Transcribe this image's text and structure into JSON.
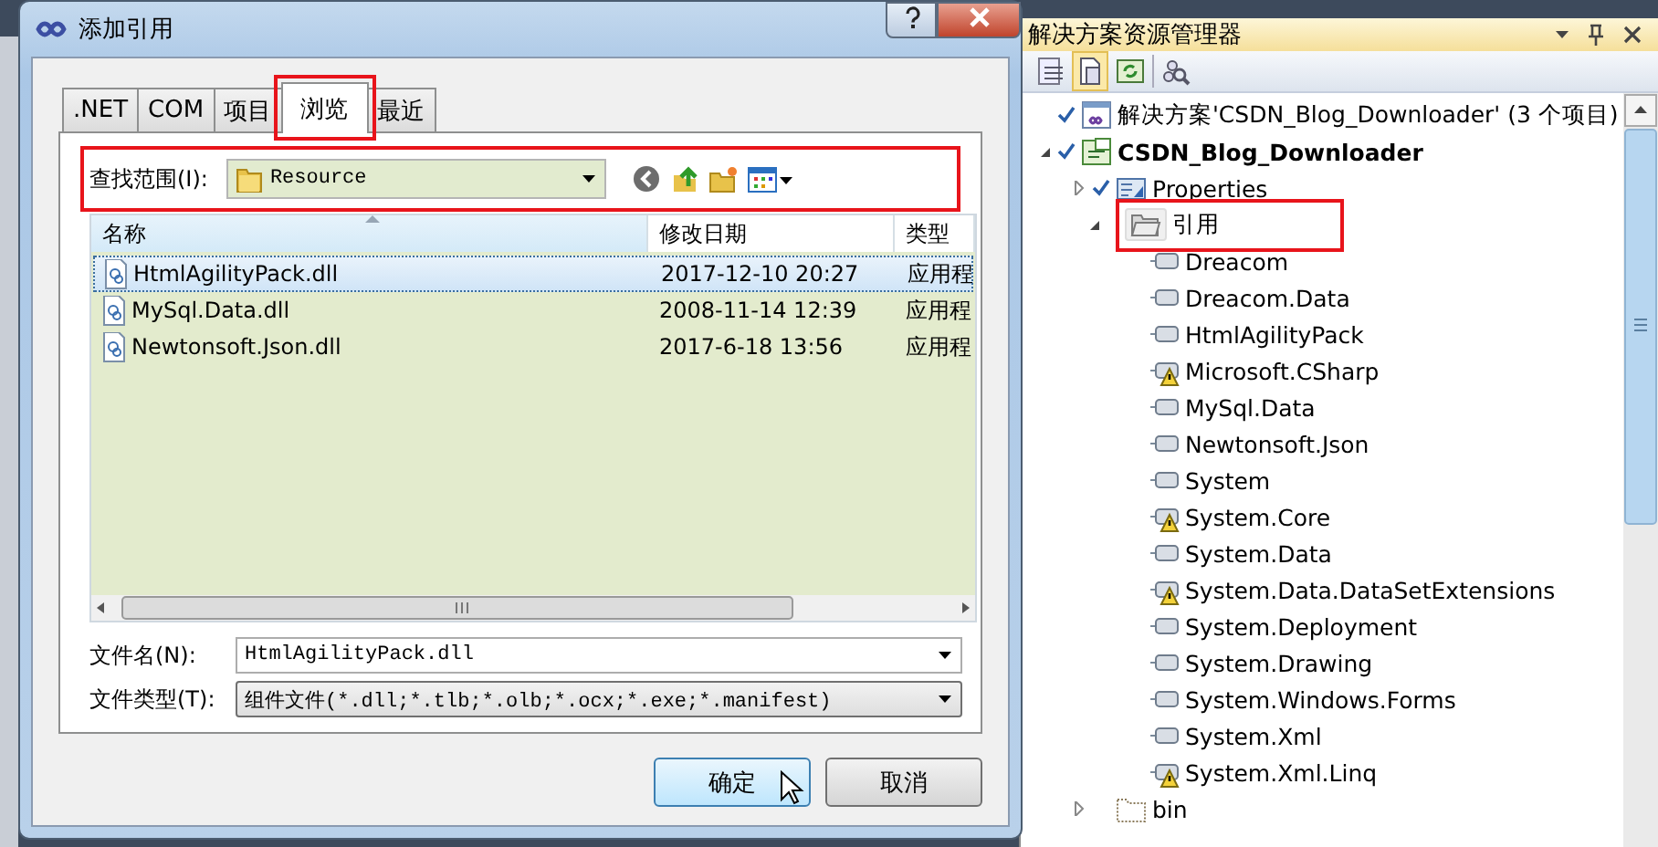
{
  "dialog": {
    "title": "添加引用",
    "tabs": [
      {
        "label": ".NET",
        "selected": false,
        "highlighted": false
      },
      {
        "label": "COM",
        "selected": false,
        "highlighted": false
      },
      {
        "label": "项目",
        "selected": false,
        "highlighted": false
      },
      {
        "label": "浏览",
        "selected": true,
        "highlighted": true
      },
      {
        "label": "最近",
        "selected": false,
        "highlighted": false
      }
    ],
    "look_in": {
      "label": "查找范围(I):",
      "value": "Resource",
      "highlighted": true
    },
    "columns": [
      {
        "label": "名称",
        "sorted": true
      },
      {
        "label": "修改日期",
        "sorted": false
      },
      {
        "label": "类型",
        "sorted": false
      }
    ],
    "files": [
      {
        "name": "HtmlAgilityPack.dll",
        "date": "2017-12-10 20:27",
        "type": "应用程",
        "selected": true
      },
      {
        "name": "MySql.Data.dll",
        "date": "2008-11-14 12:39",
        "type": "应用程",
        "selected": false
      },
      {
        "name": "Newtonsoft.Json.dll",
        "date": "2017-6-18 13:56",
        "type": "应用程",
        "selected": false
      }
    ],
    "file_name": {
      "label": "文件名(N):",
      "value": "HtmlAgilityPack.dll"
    },
    "file_type": {
      "label": "文件类型(T):",
      "value": "组件文件(*.dll;*.tlb;*.olb;*.ocx;*.exe;*.manifest)"
    },
    "buttons": [
      {
        "label": "确定",
        "hovered": true
      },
      {
        "label": "取消",
        "hovered": false
      }
    ]
  },
  "solution_explorer": {
    "title": "解决方案资源管理器",
    "tree": [
      {
        "label": "解决方案'CSDN_Blog_Downloader' (3 个项目)",
        "kind": "solution",
        "checked": true,
        "highlighted": false
      },
      {
        "label": "CSDN_Blog_Downloader",
        "kind": "project",
        "checked": true,
        "expanded": true,
        "highlighted": false,
        "children": [
          {
            "label": "Properties",
            "kind": "properties",
            "checked": true,
            "expanded": false,
            "highlighted": false
          },
          {
            "label": "引用",
            "kind": "references",
            "checked": false,
            "expanded": true,
            "highlighted": true,
            "children": [
              {
                "label": "Dreacom",
                "kind": "reference",
                "checked": false,
                "warning": false,
                "highlighted": false
              },
              {
                "label": "Dreacom.Data",
                "kind": "reference",
                "checked": false,
                "warning": false,
                "highlighted": false
              },
              {
                "label": "HtmlAgilityPack",
                "kind": "reference",
                "checked": false,
                "warning": false,
                "highlighted": false
              },
              {
                "label": "Microsoft.CSharp",
                "kind": "reference",
                "checked": false,
                "warning": true,
                "highlighted": false
              },
              {
                "label": "MySql.Data",
                "kind": "reference",
                "checked": false,
                "warning": false,
                "highlighted": false
              },
              {
                "label": "Newtonsoft.Json",
                "kind": "reference",
                "checked": false,
                "warning": false,
                "highlighted": false
              },
              {
                "label": "System",
                "kind": "reference",
                "checked": false,
                "warning": false,
                "highlighted": false
              },
              {
                "label": "System.Core",
                "kind": "reference",
                "checked": false,
                "warning": true,
                "highlighted": false
              },
              {
                "label": "System.Data",
                "kind": "reference",
                "checked": false,
                "warning": false,
                "highlighted": false
              },
              {
                "label": "System.Data.DataSetExtensions",
                "kind": "reference",
                "checked": false,
                "warning": true,
                "highlighted": false
              },
              {
                "label": "System.Deployment",
                "kind": "reference",
                "checked": false,
                "warning": false,
                "highlighted": false
              },
              {
                "label": "System.Drawing",
                "kind": "reference",
                "checked": false,
                "warning": false,
                "highlighted": false
              },
              {
                "label": "System.Windows.Forms",
                "kind": "reference",
                "checked": false,
                "warning": false,
                "highlighted": false
              },
              {
                "label": "System.Xml",
                "kind": "reference",
                "checked": false,
                "warning": false,
                "highlighted": false
              },
              {
                "label": "System.Xml.Linq",
                "kind": "reference",
                "checked": false,
                "warning": true,
                "highlighted": false
              }
            ]
          },
          {
            "label": "bin",
            "kind": "folder",
            "checked": false,
            "expanded": false,
            "highlighted": false
          }
        ]
      }
    ]
  }
}
